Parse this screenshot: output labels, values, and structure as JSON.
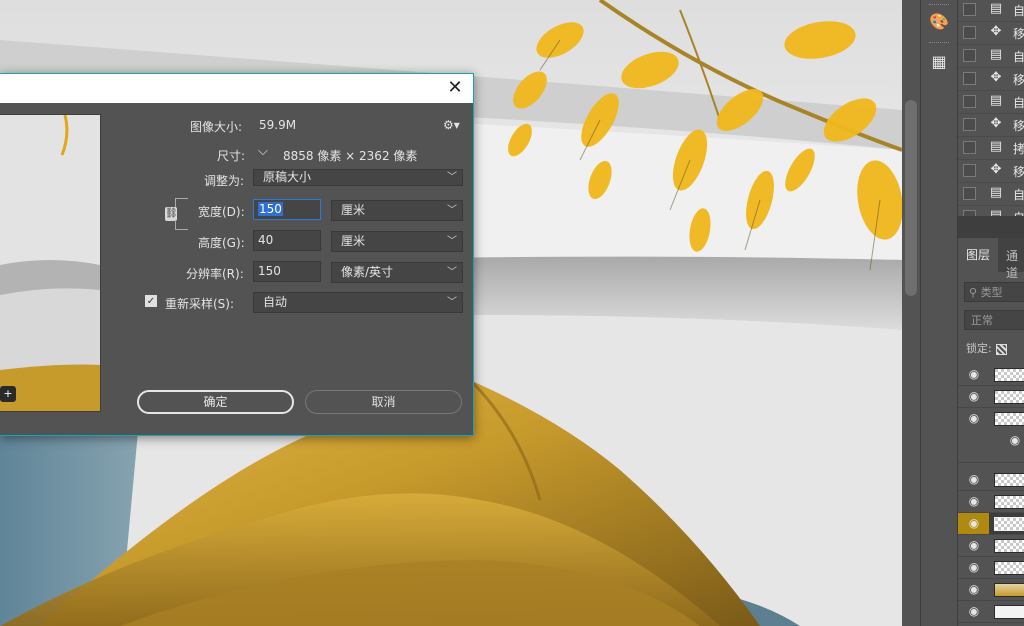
{
  "dialog": {
    "close_glyph": "✕",
    "image_size_label": "图像大小:",
    "image_size_value": "59.9M",
    "gear_glyph": "⚙▾",
    "dimensions_label": "尺寸:",
    "dimensions_chevron": "⌵",
    "dimensions_value": "8858 像素  ×  2362 像素",
    "fit_to_label": "调整为:",
    "fit_to_value": "原稿大小",
    "width_label": "宽度(D):",
    "width_value": "150",
    "width_unit": "厘米",
    "height_label": "高度(G):",
    "height_value": "40",
    "height_unit": "厘米",
    "resolution_label": "分辨率(R):",
    "resolution_value": "150",
    "resolution_unit": "像素/英寸",
    "resample_label": "重新采样(S):",
    "resample_checked_glyph": "✓",
    "resample_value": "自动",
    "ok_label": "确定",
    "cancel_label": "取消",
    "zoom_glyph": "+"
  },
  "history": {
    "items": [
      {
        "icon": "▤",
        "text": "自"
      },
      {
        "icon": "✥",
        "text": "移"
      },
      {
        "icon": "▤",
        "text": "自"
      },
      {
        "icon": "✥",
        "text": "移"
      },
      {
        "icon": "▤",
        "text": "自"
      },
      {
        "icon": "✥",
        "text": "移"
      },
      {
        "icon": "▤",
        "text": "拷"
      },
      {
        "icon": "✥",
        "text": "移"
      },
      {
        "icon": "▤",
        "text": "自"
      },
      {
        "icon": "▤",
        "text": "自"
      }
    ]
  },
  "layers": {
    "tab_active": "图层",
    "tab_inactive": "通道",
    "search_placeholder": "类型",
    "search_icon": "⚲",
    "blend_mode": "正常",
    "lock_label": "锁定:",
    "eye_glyph": "◉"
  },
  "tools": {
    "palette_icon": "🎨",
    "gradient_icon": "▦"
  },
  "colors": {
    "dialog_bg": "#535353",
    "dialog_border": "#16a6b8",
    "focus_blue": "#2b7bd3",
    "selected_layer_eye": "#b08a10",
    "mountain_gold": "#c79a2c",
    "water_blue": "#6f8fa0"
  }
}
